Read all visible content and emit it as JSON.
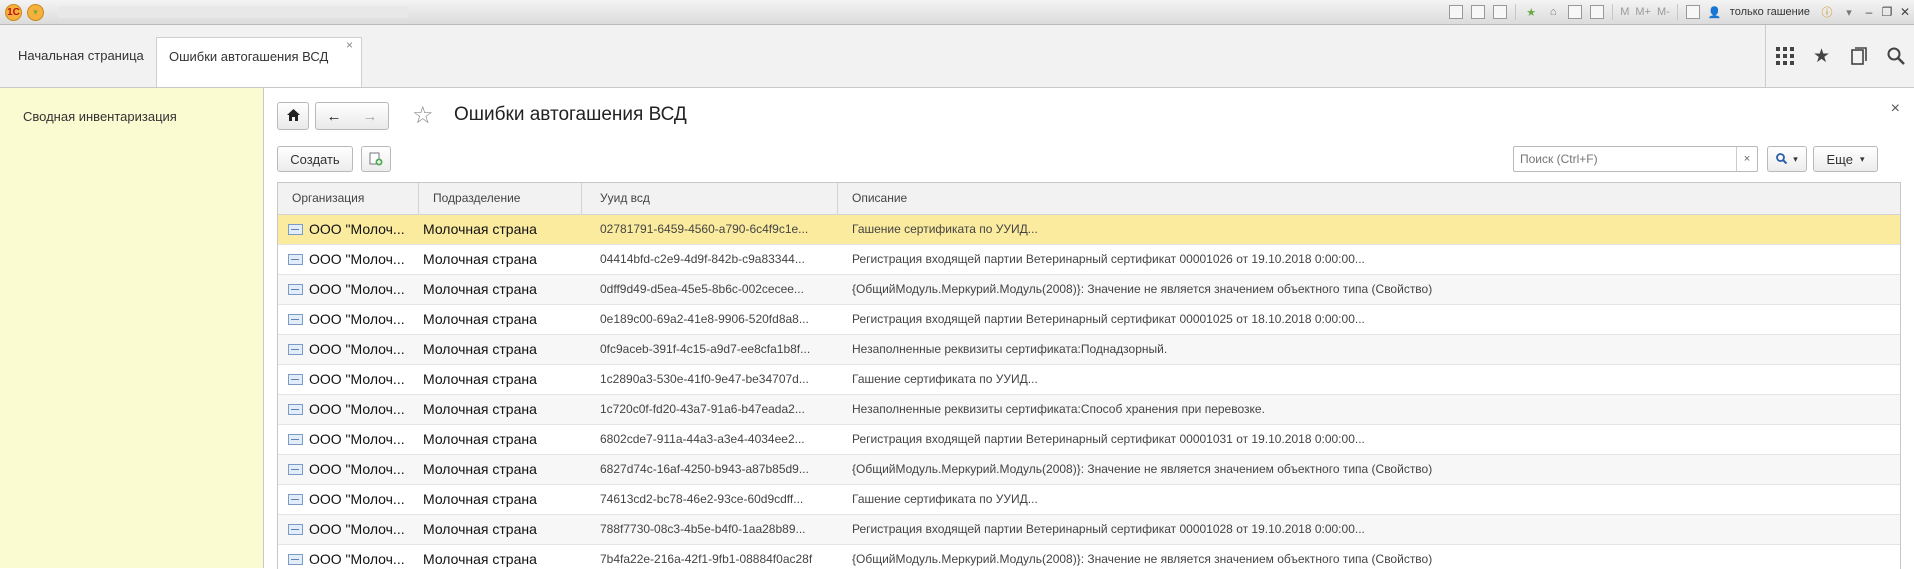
{
  "window": {
    "user": "только гашение",
    "mem_buttons": [
      "M",
      "M+",
      "M-"
    ]
  },
  "tabs": {
    "home": "Начальная страница",
    "active": "Ошибки автогашения ВСД",
    "close": "×"
  },
  "sidebar": {
    "items": [
      {
        "label": "Сводная инвентаризация"
      }
    ]
  },
  "page": {
    "title": "Ошибки автогашения ВСД",
    "close": "×"
  },
  "toolbar": {
    "create_label": "Создать",
    "search_placeholder": "Поиск (Ctrl+F)",
    "search_clear": "×",
    "more_label": "Еще"
  },
  "table": {
    "columns": [
      "Организация",
      "Подразделение",
      "Ууид всд",
      "Описание"
    ],
    "rows": [
      {
        "org": "ООО \"Молоч...",
        "div": "Молочная страна",
        "uuid": "02781791-6459-4560-a790-6c4f9c1e...",
        "desc": "Гашение сертификата по УУИД..."
      },
      {
        "org": "ООО \"Молоч...",
        "div": "Молочная страна",
        "uuid": "04414bfd-c2e9-4d9f-842b-c9a83344...",
        "desc": "Регистрация входящей партии Ветеринарный сертификат 00001026 от 19.10.2018 0:00:00..."
      },
      {
        "org": "ООО \"Молоч...",
        "div": "Молочная страна",
        "uuid": "0dff9d49-d5ea-45e5-8b6c-002cecee...",
        "desc": "{ОбщийМодуль.Меркурий.Модуль(2008)}: Значение не является значением объектного типа (Свойство)"
      },
      {
        "org": "ООО \"Молоч...",
        "div": "Молочная страна",
        "uuid": "0e189c00-69a2-41e8-9906-520fd8a8...",
        "desc": "Регистрация входящей партии Ветеринарный сертификат 00001025 от 18.10.2018 0:00:00..."
      },
      {
        "org": "ООО \"Молоч...",
        "div": "Молочная страна",
        "uuid": "0fc9aceb-391f-4c15-a9d7-ee8cfa1b8f...",
        "desc": "Незаполненные реквизиты сертификата:Поднадзорный."
      },
      {
        "org": "ООО \"Молоч...",
        "div": "Молочная страна",
        "uuid": "1c2890a3-530e-41f0-9e47-be34707d...",
        "desc": "Гашение сертификата по УУИД..."
      },
      {
        "org": "ООО \"Молоч...",
        "div": "Молочная страна",
        "uuid": "1c720c0f-fd20-43a7-91a6-b47eada2...",
        "desc": "Незаполненные реквизиты сертификата:Способ хранения при перевозке."
      },
      {
        "org": "ООО \"Молоч...",
        "div": "Молочная страна",
        "uuid": "6802cde7-911a-44a3-a3e4-4034ee2...",
        "desc": "Регистрация входящей партии Ветеринарный сертификат 00001031 от 19.10.2018 0:00:00..."
      },
      {
        "org": "ООО \"Молоч...",
        "div": "Молочная страна",
        "uuid": "6827d74c-16af-4250-b943-a87b85d9...",
        "desc": "{ОбщийМодуль.Меркурий.Модуль(2008)}: Значение не является значением объектного типа (Свойство)"
      },
      {
        "org": "ООО \"Молоч...",
        "div": "Молочная страна",
        "uuid": "74613cd2-bc78-46e2-93ce-60d9cdff...",
        "desc": "Гашение сертификата по УУИД..."
      },
      {
        "org": "ООО \"Молоч...",
        "div": "Молочная страна",
        "uuid": "788f7730-08c3-4b5e-b4f0-1aa28b89...",
        "desc": "Регистрация входящей партии Ветеринарный сертификат 00001028 от 19.10.2018 0:00:00..."
      },
      {
        "org": "ООО \"Молоч...",
        "div": "Молочная страна",
        "uuid": "7b4fa22e-216a-42f1-9fb1-08884f0ac28f",
        "desc": "{ОбщийМодуль.Меркурий.Модуль(2008)}: Значение не является значением объектного типа (Свойство)"
      }
    ]
  }
}
